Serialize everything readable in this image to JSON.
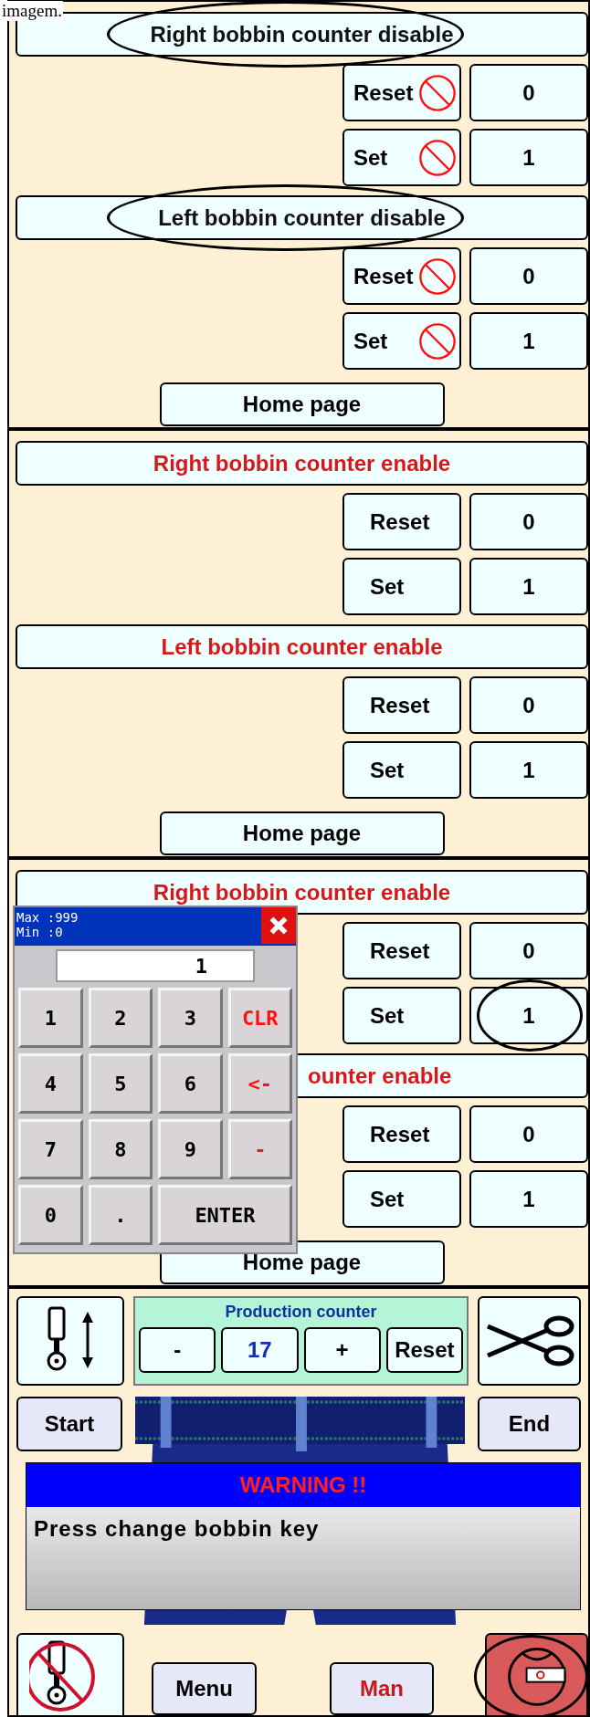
{
  "caption": "imagem.",
  "screens": [
    {
      "kind": "counter",
      "counters": [
        {
          "title": "Right bobbin counter disable",
          "enabled": false,
          "circled": true,
          "covered": false,
          "rows": [
            {
              "label": "Reset",
              "value": "0",
              "circled": false
            },
            {
              "label": "Set",
              "value": "1",
              "circled": false
            }
          ]
        },
        {
          "title": "Left bobbin counter disable",
          "enabled": false,
          "circled": true,
          "covered": false,
          "rows": [
            {
              "label": "Reset",
              "value": "0",
              "circled": false
            },
            {
              "label": "Set",
              "value": "1",
              "circled": false
            }
          ]
        }
      ],
      "home": "Home page"
    },
    {
      "kind": "counter",
      "counters": [
        {
          "title": "Right bobbin counter enable",
          "enabled": true,
          "circled": false,
          "covered": false,
          "rows": [
            {
              "label": "Reset",
              "value": "0",
              "circled": false
            },
            {
              "label": "Set",
              "value": "1",
              "circled": false
            }
          ]
        },
        {
          "title": "Left bobbin counter enable",
          "enabled": true,
          "circled": false,
          "covered": false,
          "rows": [
            {
              "label": "Reset",
              "value": "0",
              "circled": false
            },
            {
              "label": "Set",
              "value": "1",
              "circled": false
            }
          ]
        }
      ],
      "home": "Home page"
    },
    {
      "kind": "counter",
      "counters": [
        {
          "title": "Right bobbin counter enable",
          "enabled": true,
          "circled": false,
          "covered": false,
          "rows": [
            {
              "label": "Reset",
              "value": "0",
              "circled": false
            },
            {
              "label": "Set",
              "value": "1",
              "circled": true
            }
          ]
        },
        {
          "title": "ounter enable",
          "enabled": true,
          "circled": false,
          "covered": true,
          "rows": [
            {
              "label": "Reset",
              "value": "0",
              "circled": false
            },
            {
              "label": "Set",
              "value": "1",
              "circled": false
            }
          ]
        }
      ],
      "home": "Home page",
      "keypad": {
        "max": "Max :999",
        "min": "Min :0",
        "value": "1",
        "keys": [
          {
            "label": "1",
            "kind": "digit"
          },
          {
            "label": "2",
            "kind": "digit"
          },
          {
            "label": "3",
            "kind": "digit"
          },
          {
            "label": "CLR",
            "kind": "function"
          },
          {
            "label": "4",
            "kind": "digit"
          },
          {
            "label": "5",
            "kind": "digit"
          },
          {
            "label": "6",
            "kind": "digit"
          },
          {
            "label": "<-",
            "kind": "function"
          },
          {
            "label": "7",
            "kind": "digit"
          },
          {
            "label": "8",
            "kind": "digit"
          },
          {
            "label": "9",
            "kind": "digit"
          },
          {
            "label": "-",
            "kind": "function"
          },
          {
            "label": "0",
            "kind": "digit"
          },
          {
            "label": ".",
            "kind": "digit"
          },
          {
            "label": "ENTER",
            "kind": "enter"
          }
        ]
      }
    },
    {
      "kind": "production",
      "counter": {
        "title": "Production counter",
        "decrement": "-",
        "value": "17",
        "increment": "+",
        "reset": "Reset"
      },
      "start": "Start",
      "end": "End",
      "warning": {
        "title": "WARNING !!",
        "message": "Press change bobbin key"
      },
      "menu": "Menu",
      "mode": "Man",
      "bobbin_circled": true
    }
  ]
}
